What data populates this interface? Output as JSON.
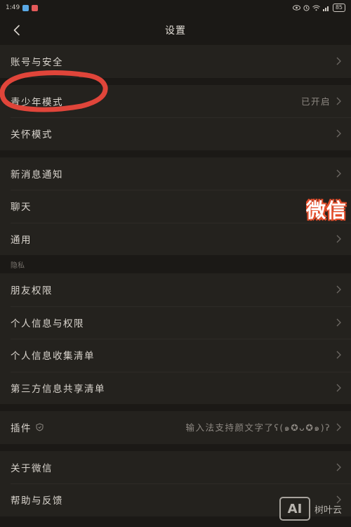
{
  "status_bar": {
    "time": "1:49",
    "battery": "85",
    "app_colors": [
      "#5aa9e6",
      "#e45a5a"
    ]
  },
  "header": {
    "title": "设置",
    "back_icon": "chevron-left-icon"
  },
  "groups": [
    {
      "items": [
        {
          "label": "账号与安全",
          "value": ""
        }
      ]
    },
    {
      "items": [
        {
          "label": "青少年模式",
          "value": "已开启"
        },
        {
          "label": "关怀模式",
          "value": ""
        }
      ]
    },
    {
      "items": [
        {
          "label": "新消息通知",
          "value": ""
        },
        {
          "label": "聊天",
          "value": ""
        },
        {
          "label": "通用",
          "value": ""
        }
      ]
    }
  ],
  "privacy": {
    "section_label": "隐私",
    "items": [
      {
        "label": "朋友权限",
        "value": ""
      },
      {
        "label": "个人信息与权限",
        "value": ""
      },
      {
        "label": "个人信息收集清单",
        "value": ""
      },
      {
        "label": "第三方信息共享清单",
        "value": ""
      }
    ]
  },
  "plugins": {
    "label": "插件",
    "icon": "shield-icon",
    "value": "输入法支持颜文字了ʕ(๑✪ᴗ✪๑)ʔ"
  },
  "about": {
    "items": [
      {
        "label": "关于微信",
        "value": ""
      },
      {
        "label": "帮助与反馈",
        "value": ""
      }
    ]
  },
  "overlay": {
    "text": "微信"
  },
  "watermark": {
    "logo": "AI",
    "text": "树叶云"
  },
  "colors": {
    "annotation": "#e0453a",
    "overlay_outline": "#e44f2d"
  }
}
